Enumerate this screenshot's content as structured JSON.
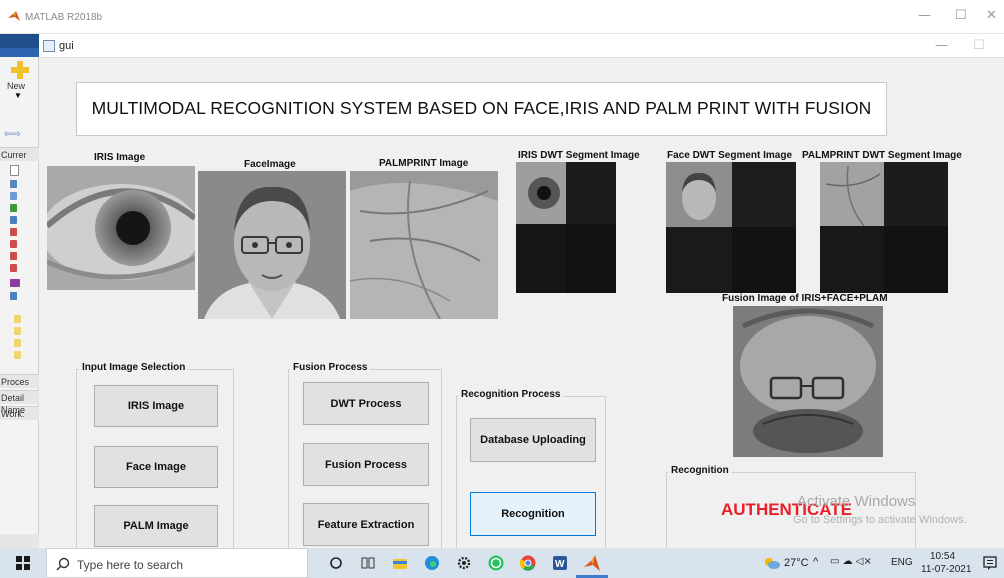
{
  "matlab": {
    "title": "MATLAB R2018b",
    "new_label": "New",
    "current_label": "Currer",
    "process_label": "Proces",
    "details_label": "Detail",
    "workspace_label": "Work:",
    "name_label": "Name"
  },
  "gui": {
    "window_title": "gui",
    "heading": "MULTIMODAL RECOGNITION SYSTEM BASED ON FACE,IRIS AND PALM PRINT WITH FUSION",
    "image_labels": {
      "iris": "IRIS Image",
      "face": "FaceImage",
      "palm": "PALMPRINT Image",
      "iris_dwt": "IRIS DWT Segment Image",
      "face_dwt": "Face DWT Segment Image",
      "palm_dwt": "PALMPRINT DWT Segment Image",
      "fusion": "Fusion Image of IRIS+FACE+PLAM"
    },
    "input_panel": {
      "title": "Input Image Selection",
      "buttons": [
        "IRIS Image",
        "Face Image",
        "PALM Image"
      ]
    },
    "fusion_panel": {
      "title": "Fusion Process",
      "buttons": [
        "DWT Process",
        "Fusion Process",
        "Feature Extraction"
      ]
    },
    "recognition_process_panel": {
      "title": "Recognition Process",
      "buttons": [
        "Database Uploading",
        "Recognition"
      ]
    },
    "recognition_panel": {
      "title": "Recognition",
      "result": "AUTHENTICATE"
    }
  },
  "watermark": {
    "line1": "Activate Windows",
    "line2": "Go to Settings to activate Windows."
  },
  "taskbar": {
    "search_placeholder": "Type here to search",
    "weather": "27°C",
    "language": "ENG",
    "time": "10:54",
    "date": "11-07-2021"
  },
  "colors": {
    "result_red": "#e8202a",
    "matlab_blue": "#1f4e8c",
    "active_button_border": "#0078d7"
  },
  "icons": [
    "matlab-logo-icon",
    "windows-start-icon",
    "search-icon",
    "cortana-icon",
    "task-view-icon",
    "file-explorer-icon",
    "edge-icon",
    "settings-icon",
    "whatsapp-icon",
    "chrome-icon",
    "word-icon",
    "matlab-taskbar-icon",
    "weather-icon",
    "notification-icon"
  ]
}
